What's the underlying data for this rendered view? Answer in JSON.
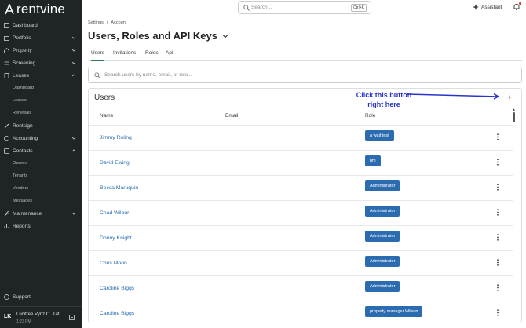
{
  "brand": {
    "name": "rentvine"
  },
  "sidebar": {
    "items": [
      {
        "label": "Dashboard",
        "icon": "dashboard-icon"
      },
      {
        "label": "Portfolio",
        "icon": "portfolio-icon",
        "chevron": "down"
      },
      {
        "label": "Property",
        "icon": "property-icon",
        "chevron": "down"
      },
      {
        "label": "Screening",
        "icon": "screening-icon",
        "chevron": "down"
      },
      {
        "label": "Leases",
        "icon": "leases-icon",
        "chevron": "up"
      },
      {
        "label": "Rentsign",
        "icon": "rentsign-icon"
      },
      {
        "label": "Accounting",
        "icon": "accounting-icon",
        "chevron": "down"
      },
      {
        "label": "Contacts",
        "icon": "contacts-icon",
        "chevron": "up"
      },
      {
        "label": "Maintenance",
        "icon": "maintenance-icon",
        "chevron": "down"
      },
      {
        "label": "Reports",
        "icon": "reports-icon"
      }
    ],
    "leases_sub": [
      "Dashboard",
      "Leases",
      "Renewals"
    ],
    "contacts_sub": [
      "Owners",
      "Tenants",
      "Vendors",
      "Messages"
    ],
    "support_label": "Support",
    "user": {
      "initials": "LK",
      "name": "Lucifree Vynz C. Kat",
      "time": "1:23 PM"
    }
  },
  "topbar": {
    "search_placeholder": "Search...",
    "shortcut": "Ctrl+K",
    "assistant_label": "Assistant"
  },
  "breadcrumb": [
    "Settings",
    "/",
    "Account"
  ],
  "page": {
    "title": "Users, Roles and API Keys"
  },
  "tabs": [
    {
      "label": "Users",
      "active": true
    },
    {
      "label": "Invitations",
      "active": false
    },
    {
      "label": "Roles",
      "active": false
    },
    {
      "label": "Api",
      "active": false
    }
  ],
  "user_search": {
    "placeholder": "Search users by name, email, or role..."
  },
  "card": {
    "title": "Users",
    "add_symbol": "+",
    "columns": [
      "Name",
      "Email",
      "Role"
    ],
    "rows": [
      {
        "name": "Jimmy Roling",
        "role": "a wait test"
      },
      {
        "name": "David Ewing",
        "role": "pm"
      },
      {
        "name": "Becca Maruquin",
        "role": "Administrator"
      },
      {
        "name": "Chad Wilbur",
        "role": "Administrator"
      },
      {
        "name": "Donny Knight",
        "role": "Administrator"
      },
      {
        "name": "Chris Moon",
        "role": "Administrator"
      },
      {
        "name": "Caroline Biggs",
        "role": "Administrator"
      },
      {
        "name": "Caroline Biggs",
        "role": "property manager Wilson"
      }
    ]
  },
  "annotation": {
    "text": "Click this button right here",
    "color": "#2a34c9"
  },
  "colors": {
    "sidebar_bg": "#1f2426",
    "link": "#2b6cb0",
    "badge": "#2b6cb0",
    "tab_active": "#2f7d4e"
  }
}
